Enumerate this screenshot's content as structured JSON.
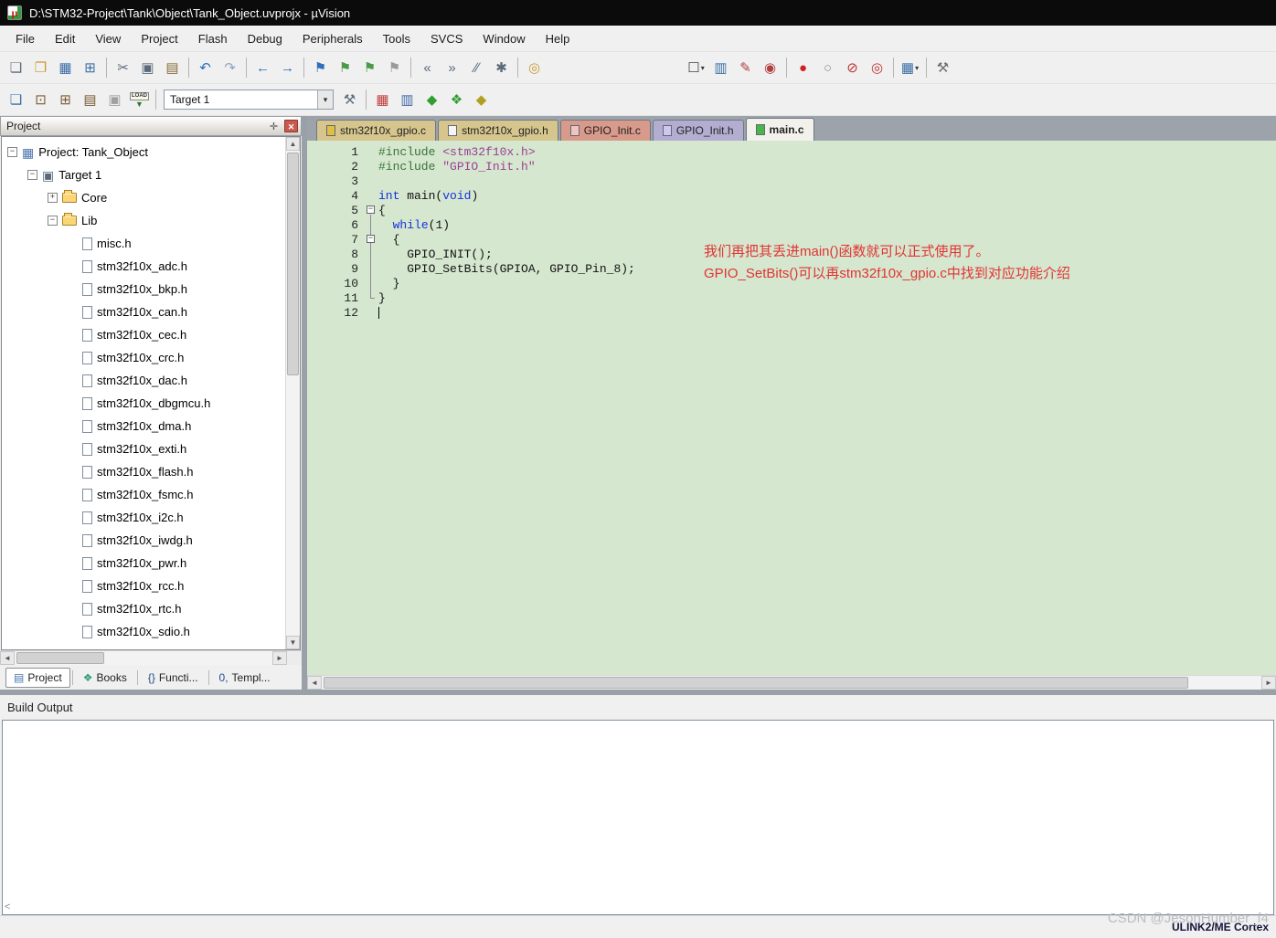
{
  "window": {
    "title": "D:\\STM32-Project\\Tank\\Object\\Tank_Object.uvprojx - µVision"
  },
  "menu": {
    "items": [
      "File",
      "Edit",
      "View",
      "Project",
      "Flash",
      "Debug",
      "Peripherals",
      "Tools",
      "SVCS",
      "Window",
      "Help"
    ]
  },
  "toolbar_main": {
    "icons": [
      {
        "name": "new-file-icon",
        "glyph": "❏",
        "color": "#5a6a7a"
      },
      {
        "name": "open-folder-icon",
        "glyph": "❐",
        "color": "#c89a30"
      },
      {
        "name": "save-icon",
        "glyph": "▦",
        "color": "#3a6ea5"
      },
      {
        "name": "save-all-icon",
        "glyph": "⊞",
        "color": "#3a6ea5"
      },
      {
        "type": "sep"
      },
      {
        "name": "cut-icon",
        "glyph": "✂",
        "color": "#5a6a7a"
      },
      {
        "name": "copy-icon",
        "glyph": "▣",
        "color": "#5a6a7a"
      },
      {
        "name": "paste-icon",
        "glyph": "▤",
        "color": "#8a6d3b"
      },
      {
        "type": "sep"
      },
      {
        "name": "undo-icon",
        "glyph": "↶",
        "color": "#2d6fbd"
      },
      {
        "name": "redo-icon",
        "glyph": "↷",
        "color": "#8ea5bd"
      },
      {
        "type": "sep"
      },
      {
        "name": "navigate-back-icon",
        "glyph": "←",
        "color": "#2d6fbd"
      },
      {
        "name": "navigate-forward-icon",
        "glyph": "→",
        "color": "#2d6fbd"
      },
      {
        "type": "sep"
      },
      {
        "name": "toggle-bookmark-icon",
        "glyph": "⚑",
        "color": "#2d6fbd"
      },
      {
        "name": "prev-bookmark-icon",
        "glyph": "⚑",
        "color": "#4a9a4a"
      },
      {
        "name": "next-bookmark-icon",
        "glyph": "⚑",
        "color": "#4a9a4a"
      },
      {
        "name": "clear-bookmarks-icon",
        "glyph": "⚑",
        "color": "#9a9a9a"
      },
      {
        "type": "sep"
      },
      {
        "name": "unindent-icon",
        "glyph": "«",
        "color": "#5a6a7a"
      },
      {
        "name": "indent-icon",
        "glyph": "»",
        "color": "#5a6a7a"
      },
      {
        "name": "comment-icon",
        "glyph": "∕∕",
        "color": "#5a6a7a"
      },
      {
        "name": "uncomment-icon",
        "glyph": "✱",
        "color": "#5a6a7a"
      },
      {
        "type": "sep"
      },
      {
        "name": "find-in-files-icon",
        "glyph": "◎",
        "color": "#c89a30"
      },
      {
        "type": "spacer"
      },
      {
        "name": "flag-checkbox",
        "glyph": "☐",
        "color": "#404040",
        "caret": true
      },
      {
        "name": "find-symbols-icon",
        "glyph": "▥",
        "color": "#3a6ea5"
      },
      {
        "name": "annotate-icon",
        "glyph": "✎",
        "color": "#b04040"
      },
      {
        "name": "search-icon",
        "glyph": "◉",
        "color": "#b04040"
      },
      {
        "type": "sep"
      },
      {
        "name": "insert-breakpoint-icon",
        "glyph": "●",
        "color": "#cc2222"
      },
      {
        "name": "remove-breakpoint-icon",
        "glyph": "○",
        "color": "#8a8a8a"
      },
      {
        "name": "kill-breakpoints-icon",
        "glyph": "⊘",
        "color": "#c03030"
      },
      {
        "name": "disable-breakpoints-icon",
        "glyph": "◎",
        "color": "#c03030"
      },
      {
        "type": "sep"
      },
      {
        "name": "debug-windows-icon",
        "glyph": "▦",
        "color": "#3a6ea5",
        "caret": true
      },
      {
        "type": "sep"
      },
      {
        "name": "configure-tools-icon",
        "glyph": "⚒",
        "color": "#707070"
      }
    ]
  },
  "toolbar_build": {
    "target": "Target 1",
    "icons": [
      {
        "name": "translate-file-icon",
        "glyph": "❏",
        "color": "#3a6ea5"
      },
      {
        "name": "build-icon",
        "glyph": "⊡",
        "color": "#7a5a30"
      },
      {
        "name": "rebuild-all-icon",
        "glyph": "⊞",
        "color": "#7a5a30"
      },
      {
        "name": "batch-build-icon",
        "glyph": "▤",
        "color": "#7a5a30"
      },
      {
        "name": "stop-build-icon",
        "glyph": "▣",
        "color": "#a0a0a0"
      },
      {
        "type": "load"
      },
      {
        "type": "sep"
      },
      {
        "type": "combo"
      },
      {
        "name": "options-for-target-icon",
        "glyph": "⚒",
        "color": "#607080"
      },
      {
        "type": "sep"
      },
      {
        "name": "manage-project-items-icon",
        "glyph": "▦",
        "color": "#c04040"
      },
      {
        "name": "file-extensions-icon",
        "glyph": "▥",
        "color": "#4068a8"
      },
      {
        "name": "manage-rte-icon",
        "glyph": "◆",
        "color": "#2f9e2f"
      },
      {
        "name": "select-packs-icon",
        "glyph": "❖",
        "color": "#2f9e2f"
      },
      {
        "name": "pack-installer-icon",
        "glyph": "◆",
        "color": "#b0a020"
      }
    ]
  },
  "project_panel": {
    "title": "Project",
    "tree": [
      {
        "label": "Project: Tank_Object",
        "depth": 0,
        "icon": "project",
        "expand": "minus"
      },
      {
        "label": "Target 1",
        "depth": 1,
        "icon": "target",
        "expand": "minus"
      },
      {
        "label": "Core",
        "depth": 2,
        "icon": "folder",
        "expand": "plus"
      },
      {
        "label": "Lib",
        "depth": 2,
        "icon": "folder",
        "expand": "minus"
      },
      {
        "label": "misc.h",
        "depth": 3,
        "icon": "file"
      },
      {
        "label": "stm32f10x_adc.h",
        "depth": 3,
        "icon": "file"
      },
      {
        "label": "stm32f10x_bkp.h",
        "depth": 3,
        "icon": "file"
      },
      {
        "label": "stm32f10x_can.h",
        "depth": 3,
        "icon": "file"
      },
      {
        "label": "stm32f10x_cec.h",
        "depth": 3,
        "icon": "file"
      },
      {
        "label": "stm32f10x_crc.h",
        "depth": 3,
        "icon": "file"
      },
      {
        "label": "stm32f10x_dac.h",
        "depth": 3,
        "icon": "file"
      },
      {
        "label": "stm32f10x_dbgmcu.h",
        "depth": 3,
        "icon": "file"
      },
      {
        "label": "stm32f10x_dma.h",
        "depth": 3,
        "icon": "file"
      },
      {
        "label": "stm32f10x_exti.h",
        "depth": 3,
        "icon": "file"
      },
      {
        "label": "stm32f10x_flash.h",
        "depth": 3,
        "icon": "file"
      },
      {
        "label": "stm32f10x_fsmc.h",
        "depth": 3,
        "icon": "file"
      },
      {
        "label": "stm32f10x_i2c.h",
        "depth": 3,
        "icon": "file"
      },
      {
        "label": "stm32f10x_iwdg.h",
        "depth": 3,
        "icon": "file"
      },
      {
        "label": "stm32f10x_pwr.h",
        "depth": 3,
        "icon": "file"
      },
      {
        "label": "stm32f10x_rcc.h",
        "depth": 3,
        "icon": "file"
      },
      {
        "label": "stm32f10x_rtc.h",
        "depth": 3,
        "icon": "file"
      },
      {
        "label": "stm32f10x_sdio.h",
        "depth": 3,
        "icon": "file"
      }
    ],
    "bottom_tabs": [
      {
        "label": "Project",
        "icon": "▤",
        "icon_color": "#4876b0",
        "active": true
      },
      {
        "label": "Books",
        "icon": "❖",
        "icon_color": "#2f9e7e",
        "active": false
      },
      {
        "label": "Functi...",
        "icon": "{}",
        "icon_color": "#284a8a",
        "active": false
      },
      {
        "label": "Templ...",
        "icon": "0,",
        "icon_color": "#284a8a",
        "active": false
      }
    ]
  },
  "editor": {
    "tabs": [
      {
        "label": "stm32f10x_gpio.c",
        "bg": "#d6c68e",
        "icon_color": "#e0c040",
        "active": false
      },
      {
        "label": "stm32f10x_gpio.h",
        "bg": "#d6c68e",
        "icon_color": "#f5f5f5",
        "active": false
      },
      {
        "label": "GPIO_Init.c",
        "bg": "#d89a8a",
        "icon_color": "#eec6c0",
        "active": false
      },
      {
        "label": "GPIO_Init.h",
        "bg": "#b3aed1",
        "icon_color": "#cfc8ee",
        "active": false
      },
      {
        "label": "main.c",
        "bg": "#f2f1ec",
        "icon_color": "#49b649",
        "active": true
      }
    ],
    "lines": [
      {
        "n": 1,
        "fold": "",
        "tokens": [
          {
            "c": "pp",
            "t": "#include "
          },
          {
            "c": "str",
            "t": "<stm32f10x.h>"
          }
        ]
      },
      {
        "n": 2,
        "fold": "",
        "tokens": [
          {
            "c": "pp",
            "t": "#include "
          },
          {
            "c": "str",
            "t": "\"GPIO_Init.h\""
          }
        ]
      },
      {
        "n": 3,
        "fold": "",
        "tokens": []
      },
      {
        "n": 4,
        "fold": "",
        "tokens": [
          {
            "c": "kw",
            "t": "int"
          },
          {
            "c": "pl",
            "t": " main("
          },
          {
            "c": "kw",
            "t": "void"
          },
          {
            "c": "pl",
            "t": ")"
          }
        ]
      },
      {
        "n": 5,
        "fold": "boxdown",
        "tokens": [
          {
            "c": "pl",
            "t": "{"
          }
        ]
      },
      {
        "n": 6,
        "fold": "v",
        "tokens": [
          {
            "c": "pl",
            "t": "  "
          },
          {
            "c": "kw",
            "t": "while"
          },
          {
            "c": "pl",
            "t": "("
          },
          {
            "c": "num",
            "t": "1"
          },
          {
            "c": "pl",
            "t": ")"
          }
        ]
      },
      {
        "n": 7,
        "fold": "boxv",
        "tokens": [
          {
            "c": "pl",
            "t": "  {"
          }
        ]
      },
      {
        "n": 8,
        "fold": "v",
        "tokens": [
          {
            "c": "pl",
            "t": "    GPIO_INIT();"
          }
        ]
      },
      {
        "n": 9,
        "fold": "v",
        "tokens": [
          {
            "c": "pl",
            "t": "    GPIO_SetBits(GPIOA, GPIO_Pin_8);"
          }
        ]
      },
      {
        "n": 10,
        "fold": "v",
        "tokens": [
          {
            "c": "pl",
            "t": "  }"
          }
        ]
      },
      {
        "n": 11,
        "fold": "end",
        "tokens": [
          {
            "c": "pl",
            "t": "}"
          }
        ]
      },
      {
        "n": 12,
        "fold": "",
        "tokens": [],
        "cursor": true
      }
    ],
    "annotations": [
      "我们再把其丢进main()函数就可以正式使用了。",
      "GPIO_SetBits()可以再stm32f10x_gpio.c中找到对应功能介绍"
    ],
    "colors": {
      "background": "#d5e7cf",
      "keyword": "#1430dc",
      "string": "#9b3d96",
      "preprocessor": "#377437",
      "annotation": "#e23333"
    }
  },
  "build_output": {
    "title": "Build Output",
    "content": ""
  },
  "status_bar": {
    "right": "ULINK2/ME Cortex"
  },
  "watermark": "CSDN @JesonHumber_f4"
}
